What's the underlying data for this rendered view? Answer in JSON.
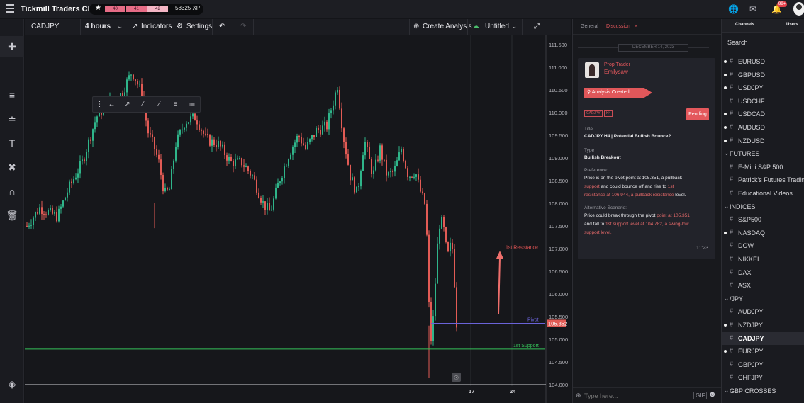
{
  "app": {
    "title": "Tickmill Traders Club",
    "xp_segments": [
      "40",
      "41",
      "42"
    ],
    "xp_total": "58325 XP",
    "notif_count": "99+"
  },
  "chart_toolbar": {
    "symbol": "CADJPY",
    "timeframe": "4 hours",
    "indicators": "Indicators",
    "settings": "Settings",
    "create_analysis": "Create Analysis",
    "layout_name": "Untitled"
  },
  "chart_data": {
    "type": "candlestick",
    "symbol": "CADJPY",
    "ylim": [
      104.0,
      111.7
    ],
    "y_ticks": [
      "111.500",
      "111.000",
      "110.500",
      "110.000",
      "109.500",
      "109.000",
      "108.500",
      "108.000",
      "107.500",
      "107.000",
      "106.500",
      "106.000",
      "105.500",
      "105.000",
      "104.500",
      "104.000"
    ],
    "x_ticks": [
      "17",
      "24"
    ],
    "current_price": "105.352",
    "levels": [
      {
        "label": "1st Resistance",
        "price": 106.944,
        "color": "#e05454"
      },
      {
        "label": "Pivot",
        "price": 105.351,
        "color": "#6a63d8"
      },
      {
        "label": "1st Support",
        "price": 104.782,
        "color": "#35c25a"
      }
    ],
    "up_color": "#2fb58a",
    "down_color": "#e25b55"
  },
  "discussion": {
    "tab_general": "General",
    "tab_discussion": "Discussion",
    "date": "DECEMBER 14, 2023",
    "author_role": "Prop Trader",
    "author_name": "Emilysaw",
    "status_banner": "Analysis Created",
    "tag_symbol": "CADJPY",
    "tag_tf": "H4",
    "status": "Pending",
    "title_label": "Title",
    "title_value": "CADJPY H4 | Potential Bullish Bounce?",
    "type_label": "Type",
    "type_value": "Bullish Breakout",
    "pref_label": "Preference:",
    "pref_p1": "Price is on the pivot point at 105.351, a pullback",
    "pref_p2a": "support",
    "pref_p2b": " and could bounce off and rise to ",
    "pref_p2c": "1st",
    "pref_p3a": "resistance at 106.944, a pullback resistance",
    "pref_p3b": " level.",
    "alt_label": "Alternative Scenario:",
    "alt_p1a": "Price could break through the pivot ",
    "alt_p1b": "point at 105.351",
    "alt_p2a": "and fall to ",
    "alt_p2b": "1st support level at 104.782, a swing-low",
    "alt_p3": "support level.",
    "time": "11:23",
    "input_placeholder": "Type here...",
    "gif": "GIF"
  },
  "channels": {
    "tab_channels": "Channels",
    "tab_users": "Users",
    "search": "Search",
    "forex": [
      {
        "name": "EURUSD",
        "dot": true
      },
      {
        "name": "GBPUSD",
        "dot": true
      },
      {
        "name": "USDJPY",
        "dot": true
      },
      {
        "name": "USDCHF",
        "dot": false
      },
      {
        "name": "USDCAD",
        "dot": true
      },
      {
        "name": "AUDUSD",
        "dot": true
      },
      {
        "name": "NZDUSD",
        "dot": true
      }
    ],
    "futures_group": "FUTURES",
    "futures": [
      "E-Mini S&P 500",
      "Patrick's Futures Trading",
      "Educational Videos"
    ],
    "indices_group": "INDICES",
    "indices": [
      {
        "name": "S&P500",
        "dot": false
      },
      {
        "name": "NASDAQ",
        "dot": true
      },
      {
        "name": "DOW",
        "dot": false
      },
      {
        "name": "NIKKEI",
        "dot": false
      },
      {
        "name": "DAX",
        "dot": false
      },
      {
        "name": "ASX",
        "dot": false
      }
    ],
    "jpy_group": "/JPY",
    "jpy": [
      {
        "name": "AUDJPY",
        "dot": false
      },
      {
        "name": "NZDJPY",
        "dot": true
      },
      {
        "name": "CADJPY",
        "dot": false,
        "selected": true
      },
      {
        "name": "EURJPY",
        "dot": true
      },
      {
        "name": "GBPJPY",
        "dot": false
      },
      {
        "name": "CHFJPY",
        "dot": false
      }
    ],
    "gbp_group": "GBP CROSSES"
  }
}
